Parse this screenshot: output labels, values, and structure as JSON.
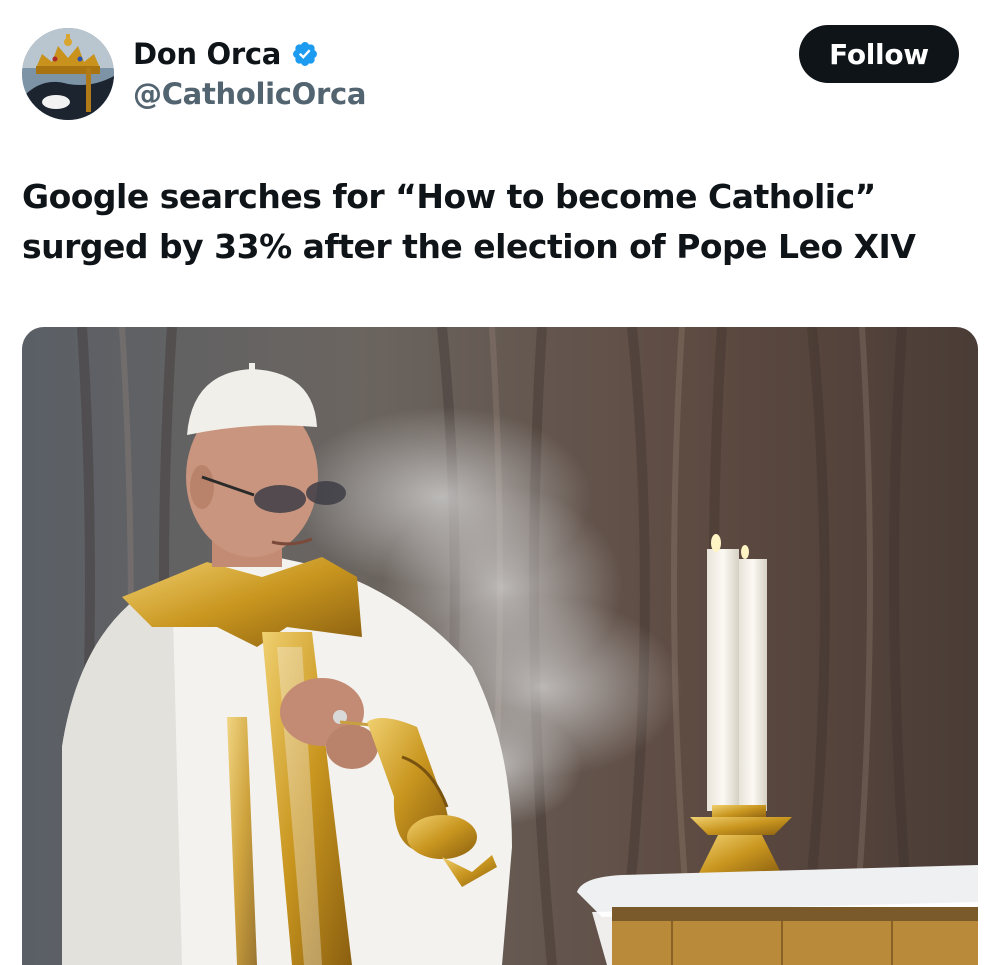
{
  "author": {
    "display_name": "Don Orca",
    "handle": "@CatholicOrca",
    "verified": true,
    "avatar_icon": "orca-crown-avatar"
  },
  "follow_button": {
    "label": "Follow"
  },
  "tweet": {
    "text": "Google searches for “How to become Catholic” surged by 33% after the election of Pope Leo XIV"
  },
  "colors": {
    "text_primary": "#0f1419",
    "text_secondary": "#536471",
    "verified_blue": "#1d9bf0",
    "button_bg": "#0f1419",
    "button_text": "#ffffff"
  }
}
